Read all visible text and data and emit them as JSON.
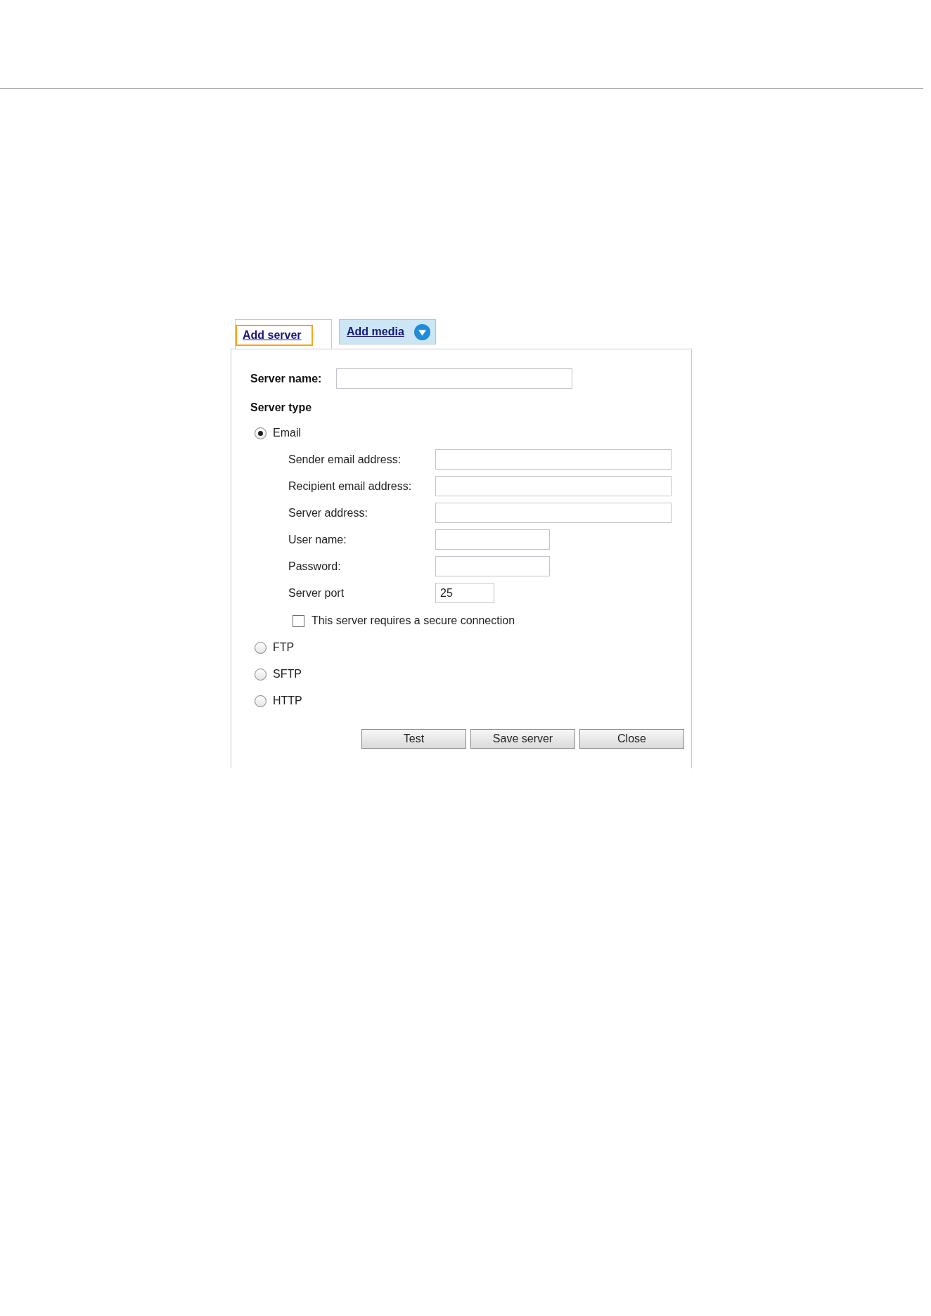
{
  "tabs": [
    {
      "label": "Add server",
      "selected": true,
      "focused": true,
      "dropdown": false
    },
    {
      "label": "Add media",
      "selected": false,
      "focused": false,
      "dropdown": true
    }
  ],
  "server_name": {
    "label": "Server name:"
  },
  "server_type": {
    "label": "Server type",
    "options": [
      {
        "label": "Email",
        "selected": true,
        "fields": [
          {
            "label": "Sender email address:",
            "kind": "long"
          },
          {
            "label": "Recipient email address:",
            "kind": "long"
          },
          {
            "label": "Server address:",
            "kind": "long"
          },
          {
            "label": "User name:",
            "kind": "short"
          },
          {
            "label": "Password:",
            "kind": "short"
          },
          {
            "label": "Server port",
            "kind": "tiny",
            "value": "25"
          }
        ],
        "checkbox": {
          "label": "This server requires a secure connection",
          "checked": false
        }
      },
      {
        "label": "FTP",
        "selected": false
      },
      {
        "label": "SFTP",
        "selected": false
      },
      {
        "label": "HTTP",
        "selected": false
      }
    ]
  },
  "buttons": [
    "Test",
    "Save server",
    "Close"
  ]
}
